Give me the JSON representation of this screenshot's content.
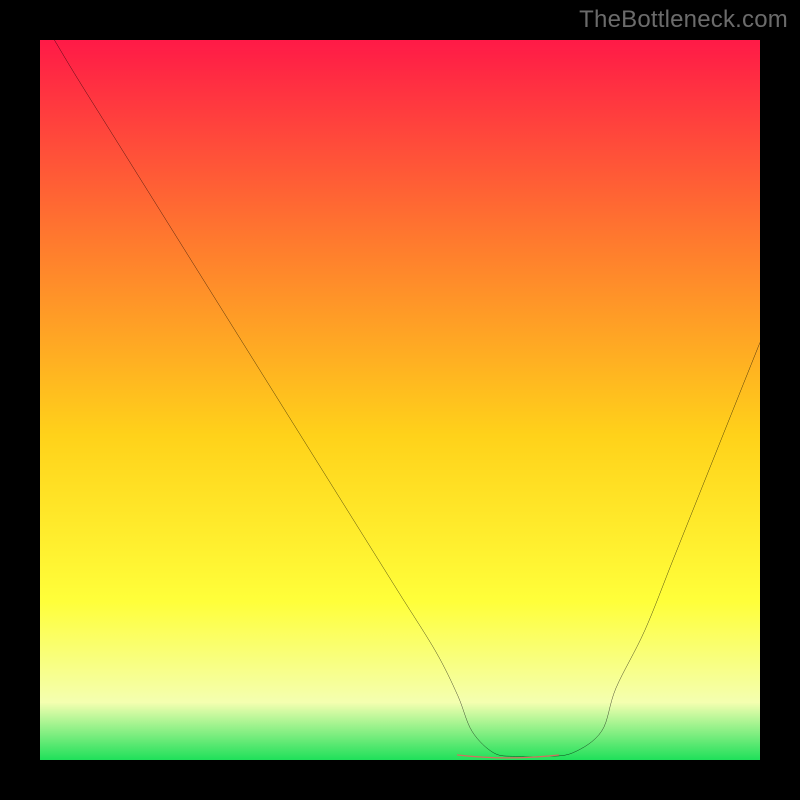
{
  "watermark": "TheBottleneck.com",
  "colors": {
    "gradient_top": "#ff1a47",
    "gradient_mid_upper": "#ff7a2e",
    "gradient_mid": "#ffd21a",
    "gradient_mid_lower": "#ffff3a",
    "gradient_low": "#f4ffb0",
    "gradient_bottom": "#1fe05a",
    "curve": "#000000",
    "accent_marker": "#d1725f",
    "frame": "#000000"
  },
  "chart_data": {
    "type": "line",
    "title": "",
    "xlabel": "",
    "ylabel": "",
    "xlim": [
      0,
      100
    ],
    "ylim": [
      0,
      100
    ],
    "grid": false,
    "legend": false,
    "series": [
      {
        "name": "curve",
        "x": [
          2,
          5,
          10,
          15,
          20,
          25,
          30,
          35,
          40,
          45,
          50,
          55,
          58,
          60,
          63,
          66,
          70,
          74,
          78,
          80,
          84,
          88,
          92,
          96,
          100
        ],
        "y": [
          100,
          95,
          87,
          79,
          71,
          63,
          55,
          47,
          39,
          31,
          23,
          15,
          9,
          4,
          1,
          0.5,
          0.5,
          1,
          4,
          10,
          18,
          28,
          38,
          48,
          58
        ]
      }
    ],
    "marker_segment": {
      "x": [
        58,
        72
      ],
      "y": [
        0.7,
        0.7
      ]
    }
  }
}
